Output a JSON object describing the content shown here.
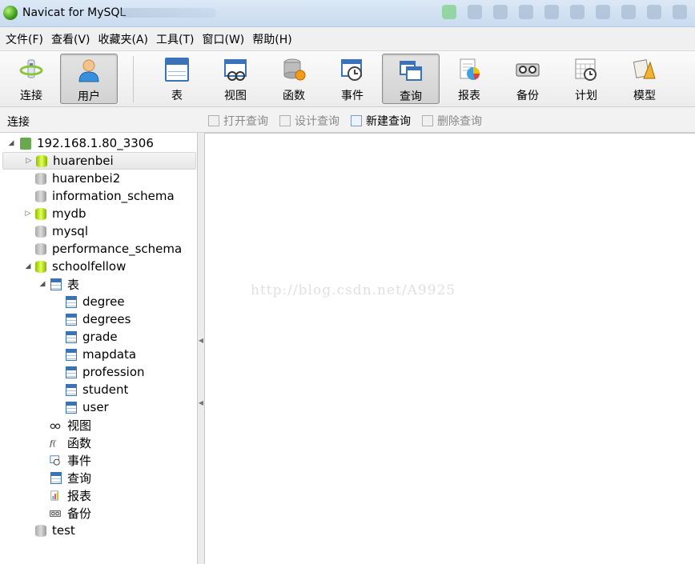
{
  "window": {
    "title": "Navicat for MySQL"
  },
  "menu": {
    "items": [
      "文件(F)",
      "查看(V)",
      "收藏夹(A)",
      "工具(T)",
      "窗口(W)",
      "帮助(H)"
    ]
  },
  "toolbar": {
    "buttons": [
      {
        "label": "连接",
        "icon": "connect-icon"
      },
      {
        "label": "用户",
        "icon": "user-icon"
      },
      {
        "label": "表",
        "icon": "table-icon"
      },
      {
        "label": "视图",
        "icon": "view-icon"
      },
      {
        "label": "函数",
        "icon": "function-icon"
      },
      {
        "label": "事件",
        "icon": "event-icon"
      },
      {
        "label": "查询",
        "icon": "query-icon"
      },
      {
        "label": "报表",
        "icon": "report-icon"
      },
      {
        "label": "备份",
        "icon": "backup-icon"
      },
      {
        "label": "计划",
        "icon": "schedule-icon"
      },
      {
        "label": "模型",
        "icon": "model-icon"
      }
    ]
  },
  "subbar": {
    "left_label": "连接",
    "actions": [
      {
        "label": "打开查询",
        "enabled": false
      },
      {
        "label": "设计查询",
        "enabled": false
      },
      {
        "label": "新建查询",
        "enabled": true
      },
      {
        "label": "删除查询",
        "enabled": false
      }
    ]
  },
  "tree": {
    "server": "192.168.1.80_3306",
    "databases": [
      "huarenbei",
      "huarenbei2",
      "information_schema",
      "mydb",
      "mysql",
      "performance_schema",
      "schoolfellow"
    ],
    "tables_group": "表",
    "tables": [
      "degree",
      "degrees",
      "grade",
      "mapdata",
      "profession",
      "student",
      "user"
    ],
    "object_groups": [
      "视图",
      "函数",
      "事件",
      "查询",
      "报表",
      "备份"
    ],
    "last_db": "test"
  },
  "main": {
    "watermark": "http://blog.csdn.net/A9925"
  },
  "colors": {
    "accent": "#3b73b9",
    "db_open": "#c6e600",
    "db_closed": "#b8b8b8"
  }
}
